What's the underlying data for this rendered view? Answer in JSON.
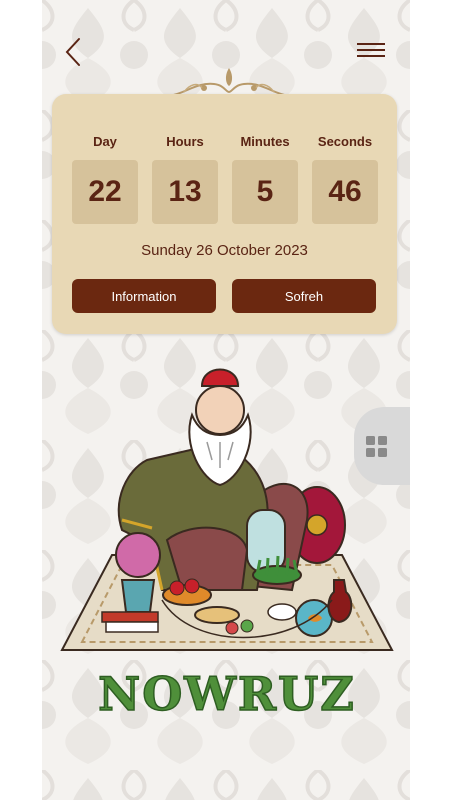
{
  "nav": {
    "back_icon": "chevron-left-icon",
    "menu_icon": "hamburger-menu-icon"
  },
  "countdown": {
    "units": [
      {
        "label": "Day",
        "value": "22"
      },
      {
        "label": "Hours",
        "value": "13"
      },
      {
        "label": "Minutes",
        "value": "5"
      },
      {
        "label": "Seconds",
        "value": "46"
      }
    ],
    "date": "Sunday 26 October 2023"
  },
  "actions": {
    "information_label": "Information",
    "sofreh_label": "Sofreh"
  },
  "side_tab": {
    "icon": "grid-icon"
  },
  "brand": {
    "title": "NOWRUZ"
  },
  "colors": {
    "card": "#e8d8b5",
    "box": "#d6c29b",
    "accent": "#6b2810",
    "text": "#5a2414",
    "brand": "#4f8f3a"
  }
}
